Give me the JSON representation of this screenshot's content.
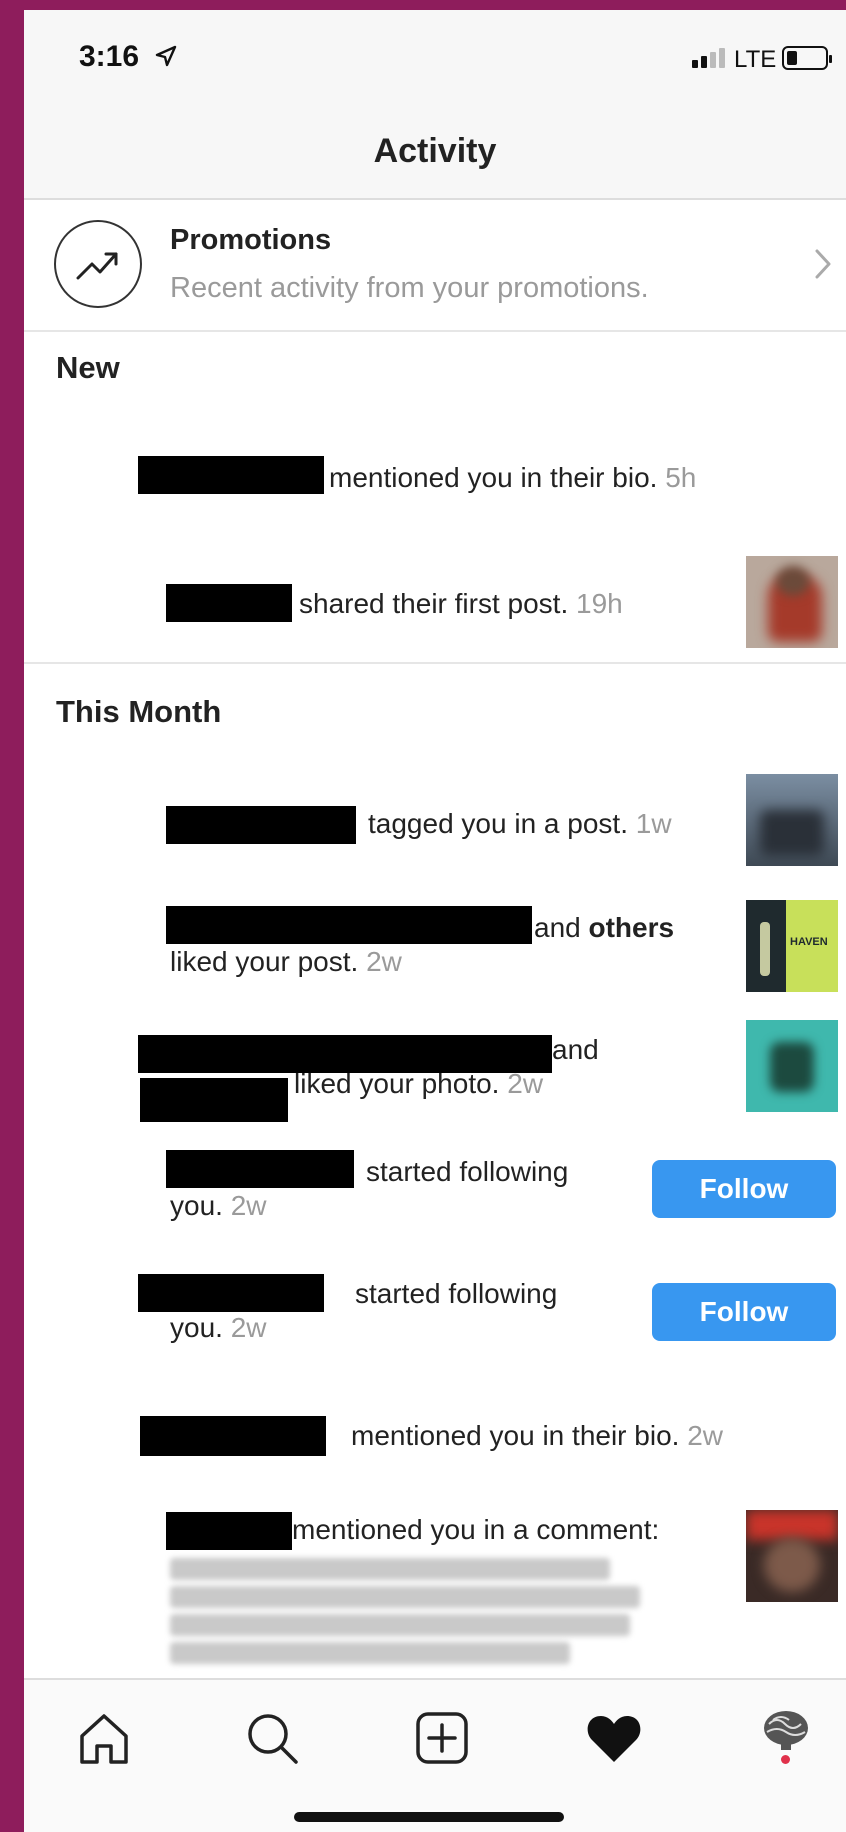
{
  "status": {
    "time": "3:16",
    "network": "LTE"
  },
  "header": {
    "title": "Activity"
  },
  "promotions": {
    "title": "Promotions",
    "subtitle": "Recent activity from your promotions."
  },
  "sections": {
    "new_title": "New",
    "month_title": "This Month"
  },
  "items": [
    {
      "text": "mentioned you in their bio.",
      "time": "5h"
    },
    {
      "text": "shared their first post.",
      "time": "19h"
    },
    {
      "text": "tagged you in a post.",
      "time": "1w"
    },
    {
      "text_a": "and",
      "text_bold": "others",
      "text_b": "liked your post.",
      "time": "2w",
      "thumb_caption": "HAVEN"
    },
    {
      "text_a": "and",
      "text_b": "liked your photo.",
      "time": "2w"
    },
    {
      "text_a": "started following",
      "text_b": "you.",
      "time": "2w",
      "button": "Follow"
    },
    {
      "text_a": "started following",
      "text_b": "you.",
      "time": "2w",
      "button": "Follow"
    },
    {
      "text": "mentioned you in their bio.",
      "time": "2w"
    },
    {
      "text": "mentioned you in a comment:"
    }
  ],
  "tabbar": {
    "items": [
      {
        "icon": "home-icon"
      },
      {
        "icon": "search-icon"
      },
      {
        "icon": "add-post-icon"
      },
      {
        "icon": "heart-icon",
        "active": true
      },
      {
        "icon": "profile-icon"
      }
    ]
  },
  "colors": {
    "accent": "#3897f0",
    "background": "#8e1d5c",
    "notification_dot": "#e0314b"
  }
}
